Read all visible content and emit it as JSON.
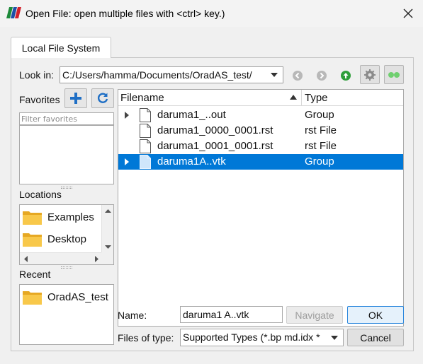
{
  "window": {
    "title": "Open File:  open multiple files with <ctrl> key.)",
    "logo_colors": [
      "#1d8a3a",
      "#1f4fa8",
      "#d3212c"
    ]
  },
  "tabs": [
    {
      "label": "Local File System",
      "active": true
    }
  ],
  "look_in": {
    "label": "Look in:",
    "value": "C:/Users/hamma/Documents/OradAS_test/"
  },
  "toolbar_icons": [
    "back-arrow-icon",
    "forward-arrow-icon",
    "parent-directory-icon",
    "gear-icon",
    "toggle-icon"
  ],
  "favorites": {
    "label": "Favorites",
    "filter_placeholder": "Filter favorites",
    "buttons": [
      "add-favorite-icon",
      "refresh-icon"
    ],
    "items": []
  },
  "locations": {
    "label": "Locations",
    "items": [
      {
        "label": "Examples"
      },
      {
        "label": "Desktop"
      }
    ]
  },
  "recent": {
    "label": "Recent",
    "items": [
      {
        "label": "OradAS_test"
      }
    ]
  },
  "file_table": {
    "columns": [
      "Filename",
      "Type"
    ],
    "sort_column": "Filename",
    "rows": [
      {
        "name": "daruma1_..out",
        "type": "Group",
        "expandable": true,
        "selected": false
      },
      {
        "name": "daruma1_0000_0001.rst",
        "type": "rst File",
        "expandable": false,
        "selected": false
      },
      {
        "name": "daruma1_0001_0001.rst",
        "type": "rst File",
        "expandable": false,
        "selected": false
      },
      {
        "name": "daruma1A..vtk",
        "type": "Group",
        "expandable": true,
        "selected": true
      }
    ]
  },
  "name_field": {
    "label": "Name:",
    "value": "daruma1 A..vtk"
  },
  "files_of_type": {
    "label": "Files of type:",
    "value": "Supported Types (*.bp md.idx *"
  },
  "buttons": {
    "navigate": "Navigate",
    "ok": "OK",
    "cancel": "Cancel"
  },
  "colors": {
    "selection": "#0078d7",
    "folder": "#f8c84a",
    "nav_green": "#2e9e3a"
  }
}
